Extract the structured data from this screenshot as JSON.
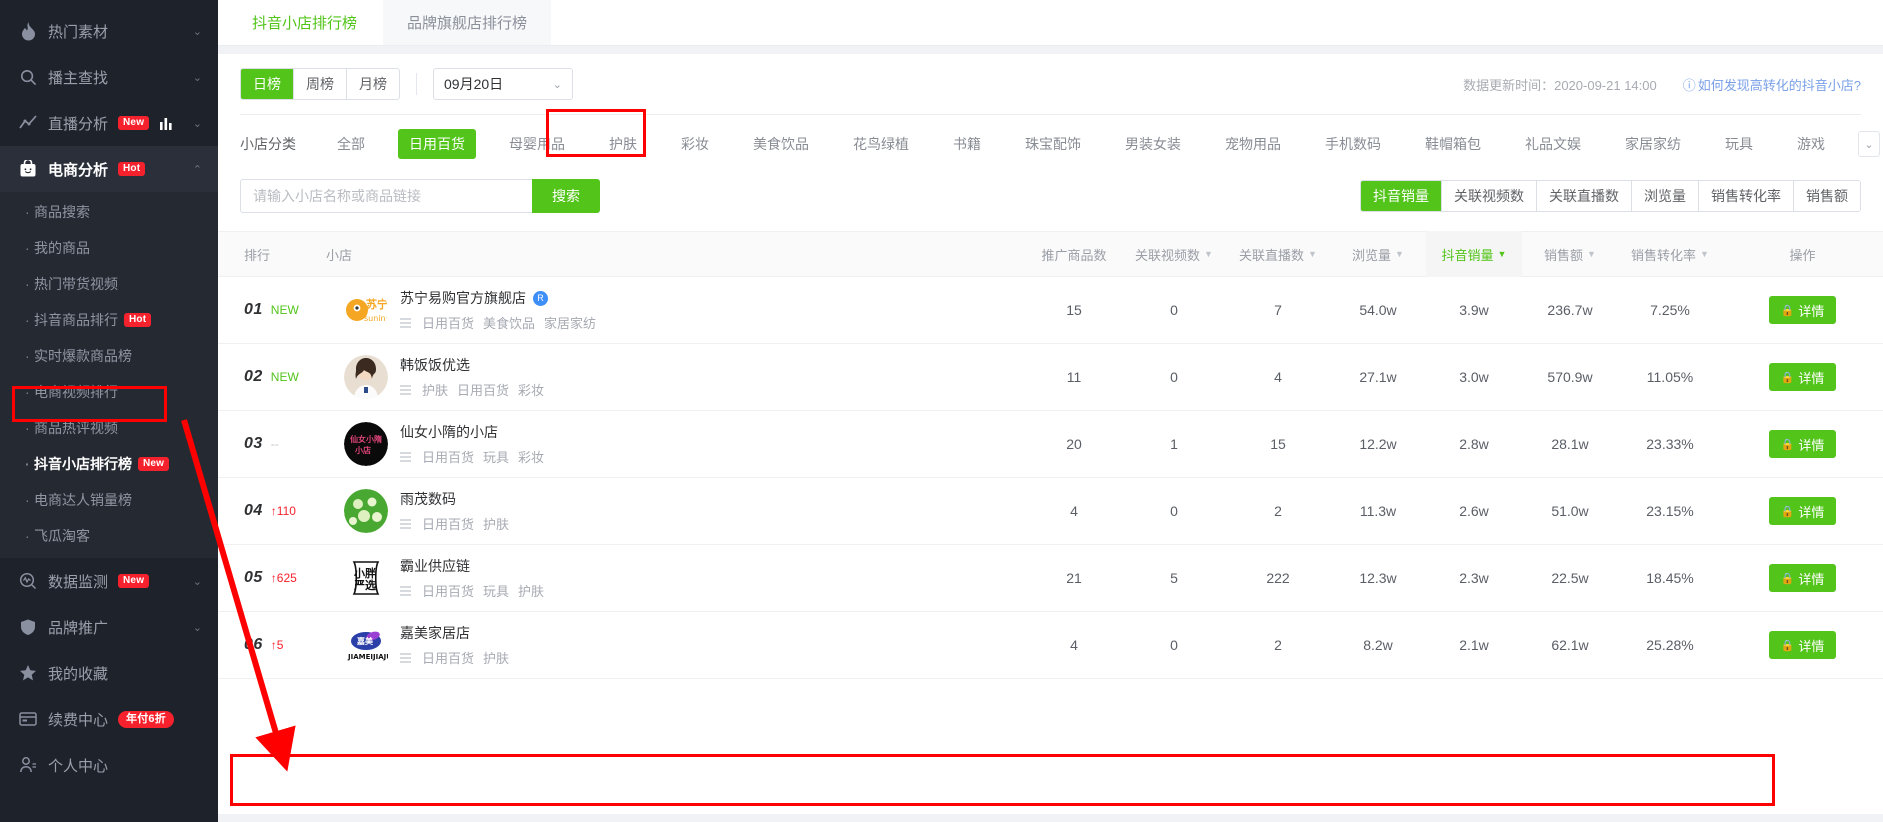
{
  "sidebar": {
    "items": [
      {
        "label": "热门素材",
        "icon": "fire-icon",
        "chevron": "⌄",
        "badge": null,
        "active": false
      },
      {
        "label": "播主查找",
        "icon": "search-icon",
        "chevron": "⌄",
        "badge": null,
        "active": false
      },
      {
        "label": "直播分析",
        "icon": "trend-icon",
        "chevron": "⌄",
        "badge": "New",
        "active": false
      },
      {
        "label": "电商分析",
        "icon": "bag-icon",
        "chevron": "⌃",
        "badge": "Hot",
        "active": true
      }
    ],
    "sub_items": [
      {
        "label": "商品搜索",
        "badge": null,
        "highlight": false
      },
      {
        "label": "我的商品",
        "badge": null,
        "highlight": false
      },
      {
        "label": "热门带货视频",
        "badge": null,
        "highlight": false
      },
      {
        "label": "抖音商品排行",
        "badge": "Hot",
        "highlight": false
      },
      {
        "label": "实时爆款商品榜",
        "badge": null,
        "highlight": false
      },
      {
        "label": "电商视频排行",
        "badge": null,
        "highlight": false
      },
      {
        "label": "商品热评视频",
        "badge": null,
        "highlight": false
      },
      {
        "label": "抖音小店排行榜",
        "badge": "New",
        "highlight": true
      },
      {
        "label": "电商达人销量榜",
        "badge": null,
        "highlight": false
      },
      {
        "label": "飞瓜淘客",
        "badge": null,
        "highlight": false
      }
    ],
    "bottom_items": [
      {
        "label": "数据监测",
        "icon": "monitor-icon",
        "chevron": "⌄",
        "badge": "New"
      },
      {
        "label": "品牌推广",
        "icon": "shield-icon",
        "chevron": "⌄",
        "badge": null
      },
      {
        "label": "我的收藏",
        "icon": "star-icon",
        "chevron": "",
        "badge": null
      },
      {
        "label": "续费中心",
        "icon": "card-icon",
        "chevron": "",
        "badge": "年付6折"
      },
      {
        "label": "个人中心",
        "icon": "user-icon",
        "chevron": "",
        "badge": null
      }
    ]
  },
  "tabs": [
    {
      "label": "抖音小店排行榜",
      "active": true
    },
    {
      "label": "品牌旗舰店排行榜",
      "active": false
    }
  ],
  "filters": {
    "period": [
      {
        "label": "日榜",
        "active": true
      },
      {
        "label": "周榜",
        "active": false
      },
      {
        "label": "月榜",
        "active": false
      }
    ],
    "date_value": "09月20日",
    "date_chevron": "⌄",
    "update_time": "数据更新时间：2020-09-21 14:00",
    "howto_label": "如何发现高转化的抖音小店?",
    "howto_icon": "question-circle-icon"
  },
  "categories": {
    "label": "小店分类",
    "items": [
      {
        "label": "全部",
        "active": false
      },
      {
        "label": "日用百货",
        "active": true
      },
      {
        "label": "母婴用品",
        "active": false
      },
      {
        "label": "护肤",
        "active": false
      },
      {
        "label": "彩妆",
        "active": false
      },
      {
        "label": "美食饮品",
        "active": false
      },
      {
        "label": "花鸟绿植",
        "active": false
      },
      {
        "label": "书籍",
        "active": false
      },
      {
        "label": "珠宝配饰",
        "active": false
      },
      {
        "label": "男装女装",
        "active": false
      },
      {
        "label": "宠物用品",
        "active": false
      },
      {
        "label": "手机数码",
        "active": false
      },
      {
        "label": "鞋帽箱包",
        "active": false
      },
      {
        "label": "礼品文娱",
        "active": false
      },
      {
        "label": "家居家纺",
        "active": false
      },
      {
        "label": "玩具",
        "active": false
      },
      {
        "label": "游戏",
        "active": false
      }
    ],
    "expand_icon": "chevron-down-icon"
  },
  "search": {
    "placeholder": "请输入小店名称或商品链接",
    "value": "",
    "button_label": "搜索"
  },
  "sort_buttons": [
    {
      "label": "抖音销量",
      "active": true
    },
    {
      "label": "关联视频数",
      "active": false
    },
    {
      "label": "关联直播数",
      "active": false
    },
    {
      "label": "浏览量",
      "active": false
    },
    {
      "label": "销售转化率",
      "active": false
    },
    {
      "label": "销售额",
      "active": false
    }
  ],
  "table": {
    "headers": [
      {
        "label": "排行",
        "sortable": false,
        "active": false
      },
      {
        "label": "小店",
        "sortable": false,
        "active": false
      },
      {
        "label": "推广商品数",
        "sortable": false,
        "active": false
      },
      {
        "label": "关联视频数",
        "sortable": true,
        "active": false
      },
      {
        "label": "关联直播数",
        "sortable": true,
        "active": false
      },
      {
        "label": "浏览量",
        "sortable": true,
        "active": false
      },
      {
        "label": "抖音销量",
        "sortable": true,
        "active": true
      },
      {
        "label": "销售额",
        "sortable": true,
        "active": false
      },
      {
        "label": "销售转化率",
        "sortable": true,
        "active": false
      },
      {
        "label": "操作",
        "sortable": false,
        "active": false
      }
    ],
    "detail_label": "详情",
    "detail_icon": "lock-icon",
    "rows": [
      {
        "rank": "01",
        "change": "NEW",
        "change_type": "new",
        "shop": "苏宁易购官方旗舰店",
        "verified": "R",
        "avatar_type": "suning",
        "tags": [
          "日用百货",
          "美食饮品",
          "家居家纺"
        ],
        "promo_items": "15",
        "video_count": "0",
        "live_count": "7",
        "views": "54.0w",
        "sales_volume": "3.9w",
        "sales_amount": "236.7w",
        "conversion": "7.25%",
        "highlight": false
      },
      {
        "rank": "02",
        "change": "NEW",
        "change_type": "new",
        "shop": "韩饭饭优选",
        "verified": "",
        "avatar_type": "girl",
        "tags": [
          "护肤",
          "日用百货",
          "彩妆"
        ],
        "promo_items": "11",
        "video_count": "0",
        "live_count": "4",
        "views": "27.1w",
        "sales_volume": "3.0w",
        "sales_amount": "570.9w",
        "conversion": "11.05%",
        "highlight": false
      },
      {
        "rank": "03",
        "change": "--",
        "change_type": "flat",
        "shop": "仙女小隋的小店",
        "verified": "",
        "avatar_type": "black",
        "tags": [
          "日用百货",
          "玩具",
          "彩妆"
        ],
        "promo_items": "20",
        "video_count": "1",
        "live_count": "15",
        "views": "12.2w",
        "sales_volume": "2.8w",
        "sales_amount": "28.1w",
        "conversion": "23.33%",
        "highlight": false
      },
      {
        "rank": "04",
        "change": "↑110",
        "change_type": "up",
        "shop": "雨茂数码",
        "verified": "",
        "avatar_type": "green",
        "tags": [
          "日用百货",
          "护肤"
        ],
        "promo_items": "4",
        "video_count": "0",
        "live_count": "2",
        "views": "11.3w",
        "sales_volume": "2.6w",
        "sales_amount": "51.0w",
        "conversion": "23.15%",
        "highlight": false
      },
      {
        "rank": "05",
        "change": "↑625",
        "change_type": "up",
        "shop": "霸业供应链",
        "verified": "",
        "avatar_type": "xiaopang",
        "tags": [
          "日用百货",
          "玩具",
          "护肤"
        ],
        "promo_items": "21",
        "video_count": "5",
        "live_count": "222",
        "views": "12.3w",
        "sales_volume": "2.3w",
        "sales_amount": "22.5w",
        "conversion": "18.45%",
        "highlight": false
      },
      {
        "rank": "06",
        "change": "↑5",
        "change_type": "up",
        "shop": "嘉美家居店",
        "verified": "",
        "avatar_type": "jiamei",
        "tags": [
          "日用百货",
          "护肤"
        ],
        "promo_items": "4",
        "video_count": "0",
        "live_count": "2",
        "views": "8.2w",
        "sales_volume": "2.1w",
        "sales_amount": "62.1w",
        "conversion": "25.28%",
        "highlight": true
      }
    ]
  },
  "colors": {
    "accent_green": "#52c41a",
    "annotation_red": "#fe0000",
    "sidebar_bg": "#1e222b",
    "link_blue": "#7aa0e8"
  }
}
